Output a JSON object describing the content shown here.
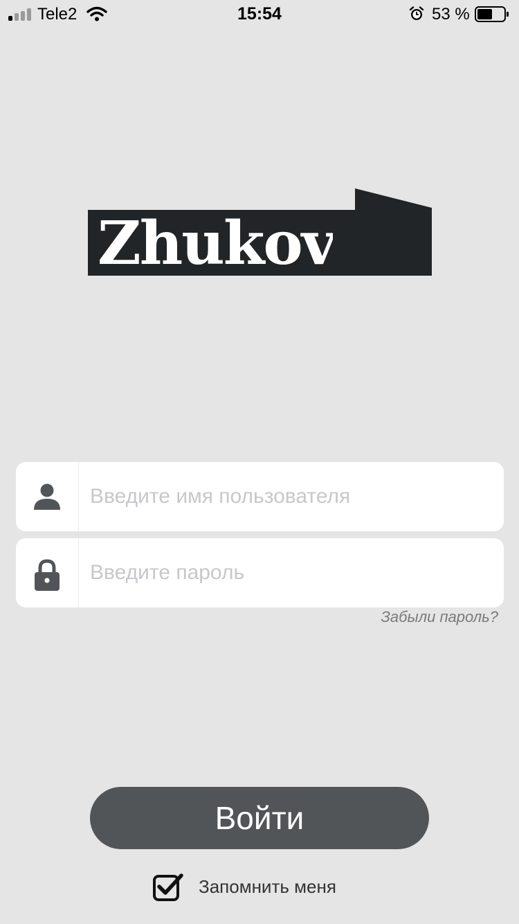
{
  "status_bar": {
    "carrier": "Tele2",
    "time": "15:54",
    "battery": "53 %",
    "icons": [
      "signal-icon",
      "wifi-icon",
      "alarm-icon",
      "battery-icon"
    ]
  },
  "logo": {
    "text": "Zhukov"
  },
  "form": {
    "username": {
      "placeholder": "Введите имя пользователя",
      "value": "",
      "icon": "user-icon"
    },
    "password": {
      "placeholder": "Введите пароль",
      "value": "",
      "icon": "lock-icon"
    },
    "forgot_password": "Забыли пароль?",
    "login_button": "Войти",
    "remember_me": {
      "label": "Запомнить меня",
      "checked": true
    }
  },
  "colors": {
    "background": "#e5e5e5",
    "logo": "#222527",
    "button": "#525557",
    "icon": "#525557",
    "placeholder": "#c8c8cc"
  }
}
